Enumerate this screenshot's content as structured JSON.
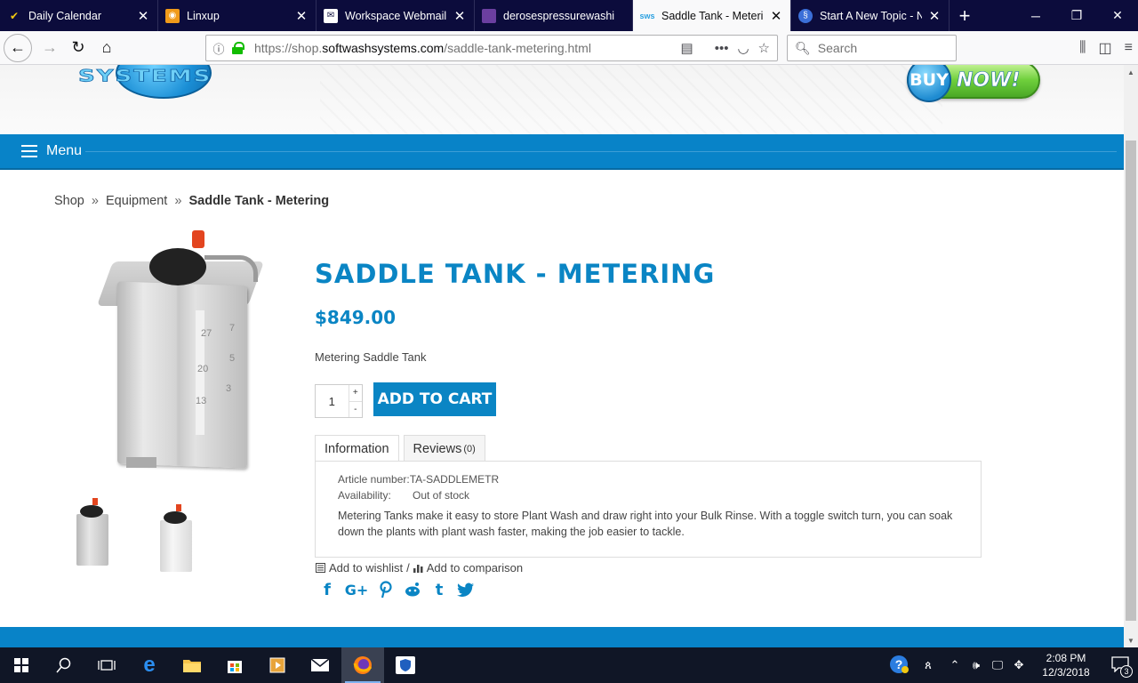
{
  "browser": {
    "tabs": [
      {
        "title": "Daily Calendar",
        "icon": "check-icon",
        "color": "#f2c811"
      },
      {
        "title": "Linxup",
        "icon": "rss-icon",
        "color": "#f09a1a"
      },
      {
        "title": "Workspace Webmail :",
        "icon": "mail-icon",
        "color": "#ffffff"
      },
      {
        "title": "derosespressurewashi",
        "icon": "site-icon",
        "color": "#6b3fa0"
      },
      {
        "title": "Saddle Tank - Metering",
        "icon": "softwash-icon",
        "color": "#2aa0e0",
        "active": true
      },
      {
        "title": "Start A New Topic - Na",
        "icon": "forum-icon",
        "color": "#3b6fd8"
      }
    ],
    "url_prefix": "https://shop.",
    "url_domain": "softwashsystems.com",
    "url_path": "/saddle-tank-metering.html",
    "search_placeholder": "Search"
  },
  "site": {
    "logo_text": "SYSTEMS",
    "buynow_buy": "BUY",
    "buynow_now": "NOW!",
    "menu_label": "Menu"
  },
  "breadcrumb": {
    "shop": "Shop",
    "sep": "»",
    "equipment": "Equipment",
    "current": "Saddle Tank - Metering"
  },
  "product": {
    "title": "SADDLE TANK - METERING",
    "price": "$849.00",
    "short_description": "Metering Saddle Tank",
    "quantity": "1",
    "qty_plus": "+",
    "qty_minus": "-",
    "add_to_cart": "ADD TO CART",
    "tank_marks": [
      "27",
      "7",
      "5",
      "20",
      "3",
      "13"
    ]
  },
  "tabs": {
    "information": "Information",
    "reviews": "Reviews",
    "reviews_count": "(0)"
  },
  "info": {
    "article_label": "Article number:",
    "article_value": "TA-SADDLEMETR",
    "availability_label": "Availability:",
    "availability_value": "Out of stock",
    "description": "Metering Tanks make it easy to store Plant Wash and draw right into your Bulk Rinse. With a toggle switch turn, you can soak down the plants with plant wash faster, making the job easier to tackle."
  },
  "actions": {
    "wishlist": "Add to wishlist",
    "separator": "/",
    "comparison": "Add to comparison"
  },
  "social": [
    "facebook-icon",
    "google-plus-icon",
    "pinterest-icon",
    "reddit-icon",
    "tumblr-icon",
    "twitter-icon"
  ],
  "taskbar": {
    "time": "2:08 PM",
    "date": "12/3/2018",
    "notifications": "3"
  },
  "colors": {
    "brand_blue": "#0a85c4",
    "menu_blue": "#0883c8",
    "buy_green": "#6fcf3c"
  }
}
